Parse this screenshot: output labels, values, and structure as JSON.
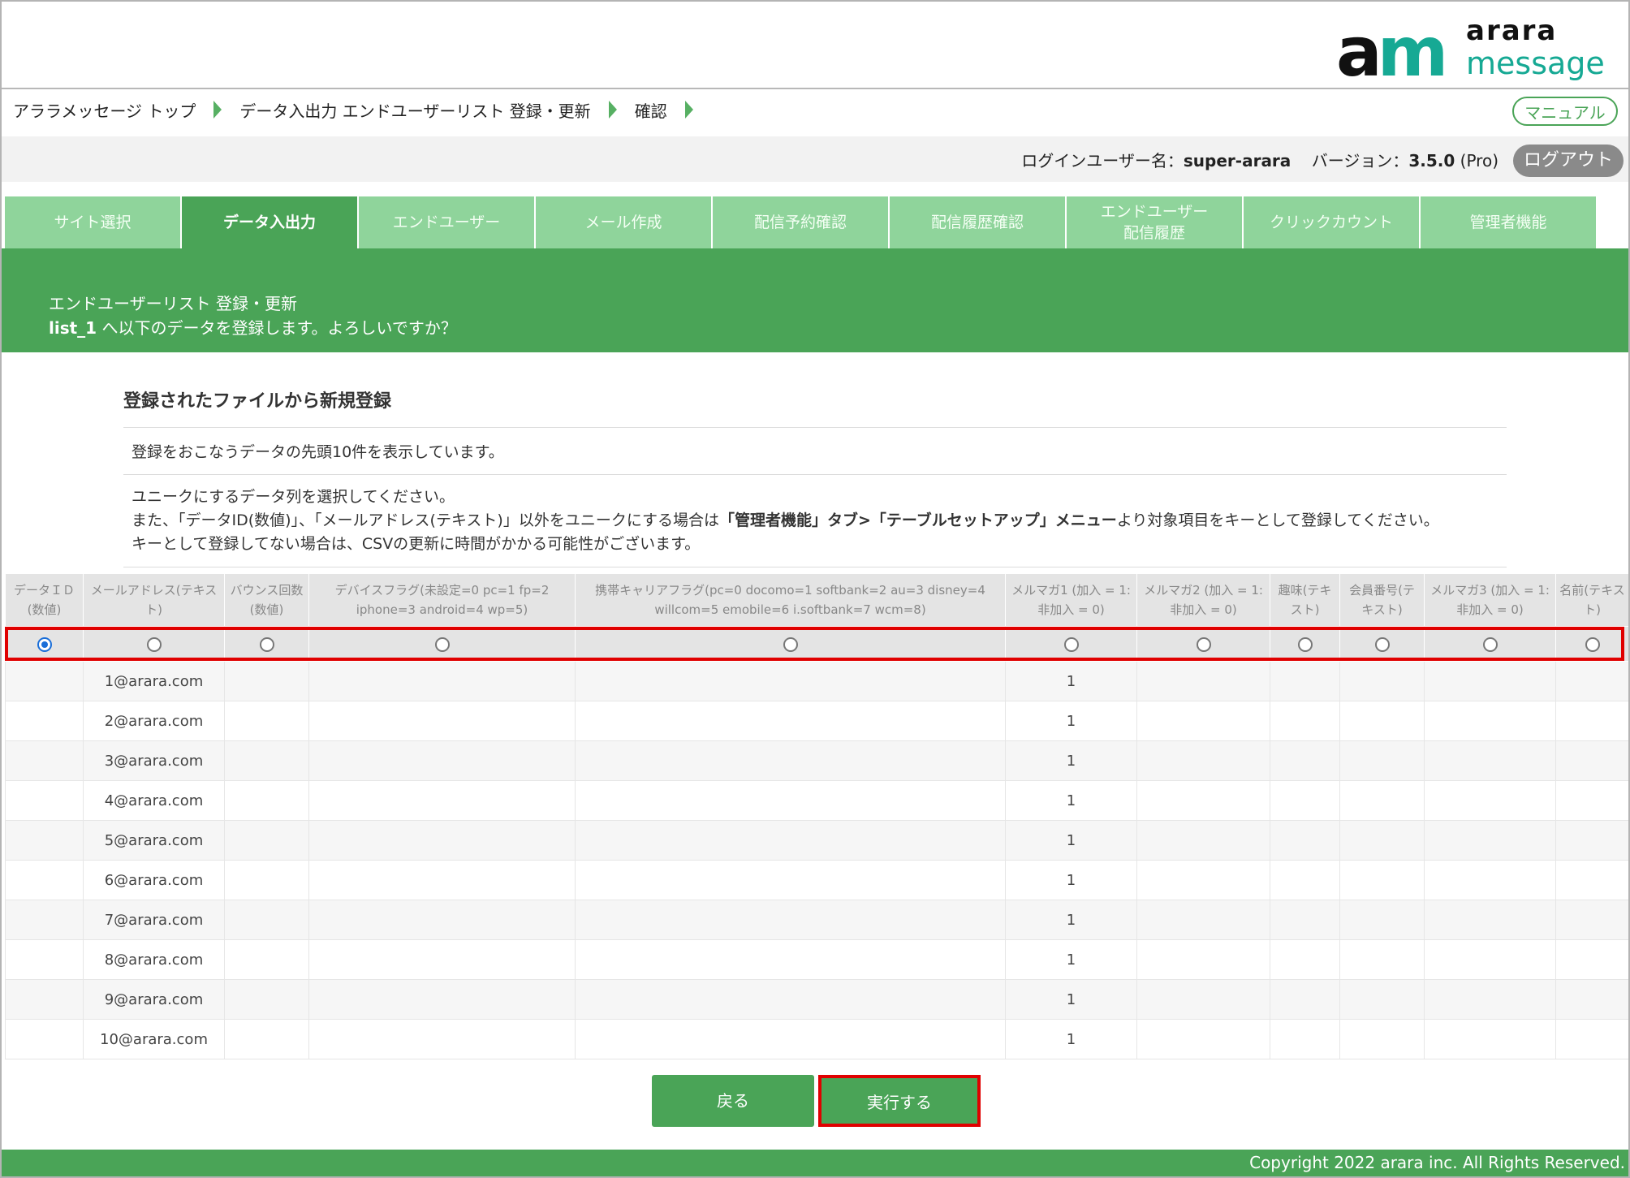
{
  "logo": {
    "mark": "am",
    "word1": "arara",
    "word2": "message"
  },
  "breadcrumb": [
    "アララメッセージ トップ",
    "データ入出力 エンドユーザーリスト 登録・更新",
    "確認"
  ],
  "header": {
    "manual_label": "マニュアル",
    "user_label": "ログインユーザー名：",
    "user_name": "super-arara",
    "version_label": "バージョン：",
    "version": "3.5.0",
    "edition": "(Pro)",
    "logout_label": "ログアウト"
  },
  "tabs": [
    {
      "label": "サイト選択",
      "active": false
    },
    {
      "label": "データ入出力",
      "active": true
    },
    {
      "label": "エンドユーザー",
      "active": false
    },
    {
      "label": "メール作成",
      "active": false
    },
    {
      "label": "配信予約確認",
      "active": false
    },
    {
      "label": "配信履歴確認",
      "active": false
    },
    {
      "label": "エンドユーザー\n配信履歴",
      "active": false
    },
    {
      "label": "クリックカウント",
      "active": false
    },
    {
      "label": "管理者機能",
      "active": false
    }
  ],
  "banner": {
    "title": "エンドユーザーリスト 登録・更新",
    "list_name": "list_1",
    "message": " へ以下のデータを登録します。よろしいですか？"
  },
  "section": {
    "title": "登録されたファイルから新規登録",
    "note1": "登録をおこなうデータの先頭10件を表示しています。",
    "note2_line1": "ユニークにするデータ列を選択してください。",
    "note2_line2_a": "また、「データID(数値)」、「メールアドレス(テキスト)」以外をユニークにする場合は",
    "note2_line2_b": "「管理者機能」タブ>「テーブルセットアップ」メニュー",
    "note2_line2_c": "より対象項目をキーとして登録してください。",
    "note2_line3": "キーとして登録してない場合は、CSVの更新に時間がかかる可能性がございます。"
  },
  "table": {
    "columns": [
      "データＩＤ(数値)",
      "メールアドレス(テキスト)",
      "バウンス回数(数値)",
      "デバイスフラグ(未設定=0 pc=1 fp=2 iphone=3 android=4 wp=5)",
      "携帯キャリアフラグ(pc=0 docomo=1 softbank=2 au=3 disney=4 willcom=5 emobile=6 i.softbank=7 wcm=8)",
      "メルマガ1 (加入 = 1:非加入 = 0)",
      "メルマガ2 (加入 = 1:非加入 = 0)",
      "趣味(テキスト)",
      "会員番号(テキスト)",
      "メルマガ3 (加入 = 1:非加入 = 0)",
      "名前(テキスト)"
    ],
    "selected_unique_column": 0,
    "rows": [
      [
        "",
        "1@arara.com",
        "",
        "",
        "",
        "1",
        "",
        "",
        "",
        "",
        ""
      ],
      [
        "",
        "2@arara.com",
        "",
        "",
        "",
        "1",
        "",
        "",
        "",
        "",
        ""
      ],
      [
        "",
        "3@arara.com",
        "",
        "",
        "",
        "1",
        "",
        "",
        "",
        "",
        ""
      ],
      [
        "",
        "4@arara.com",
        "",
        "",
        "",
        "1",
        "",
        "",
        "",
        "",
        ""
      ],
      [
        "",
        "5@arara.com",
        "",
        "",
        "",
        "1",
        "",
        "",
        "",
        "",
        ""
      ],
      [
        "",
        "6@arara.com",
        "",
        "",
        "",
        "1",
        "",
        "",
        "",
        "",
        ""
      ],
      [
        "",
        "7@arara.com",
        "",
        "",
        "",
        "1",
        "",
        "",
        "",
        "",
        ""
      ],
      [
        "",
        "8@arara.com",
        "",
        "",
        "",
        "1",
        "",
        "",
        "",
        "",
        ""
      ],
      [
        "",
        "9@arara.com",
        "",
        "",
        "",
        "1",
        "",
        "",
        "",
        "",
        ""
      ],
      [
        "",
        "10@arara.com",
        "",
        "",
        "",
        "1",
        "",
        "",
        "",
        "",
        ""
      ]
    ]
  },
  "buttons": {
    "back": "戻る",
    "execute": "実行する"
  },
  "footer": {
    "copyright": "Copyright 2022 arara inc. All Rights Reserved."
  },
  "colors": {
    "brand_green": "#4aa457",
    "tab_green": "#8fd49b",
    "logo_teal": "#16a994",
    "highlight_red": "#e00000"
  }
}
